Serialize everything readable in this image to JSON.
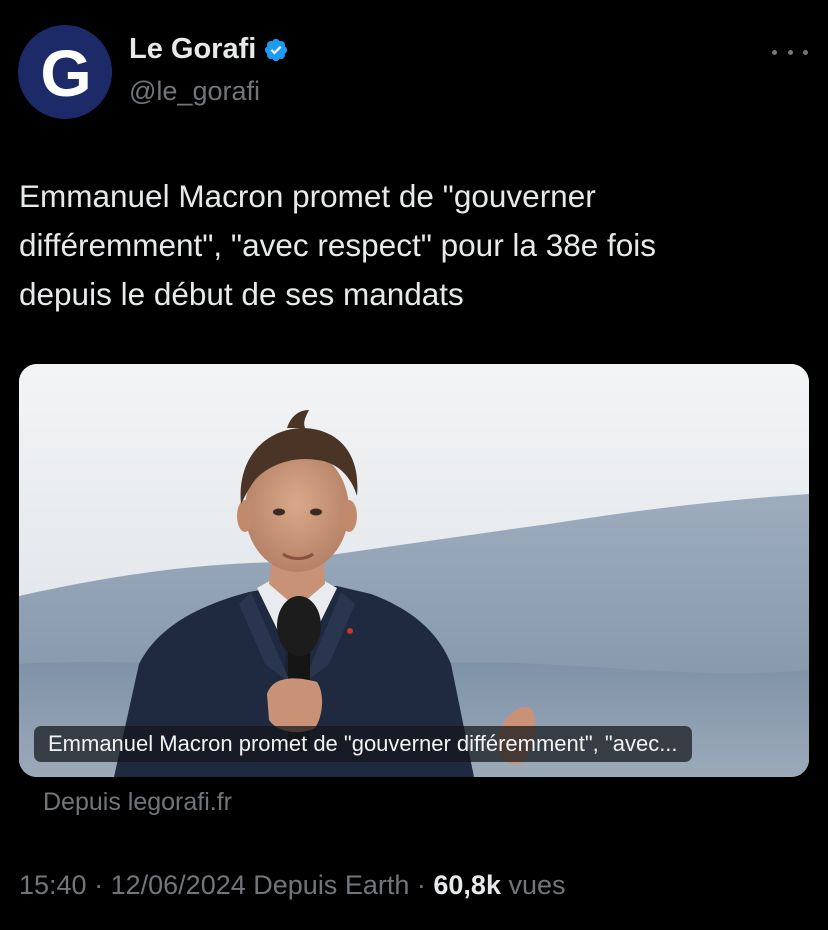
{
  "account": {
    "avatar_letter": "G",
    "display_name": "Le Gorafi",
    "handle": "@le_gorafi",
    "verified_icon": "verified-badge-icon",
    "avatar_color": "#1d2a68",
    "verified_color": "#1d9bf0"
  },
  "tweet": {
    "text": "Emmanuel Macron promet de \"gouverner\ndifféremment\", \"avec respect\" pour la 38e fois\ndepuis le début de ses mandats"
  },
  "card": {
    "caption": "Emmanuel Macron promet de \"gouverner différemment\", \"avec...",
    "source": "Depuis legorafi.fr"
  },
  "meta": {
    "time": "15:40",
    "date": "12/06/2024",
    "client": "Depuis Earth",
    "separator": "·",
    "views_count": "60,8k",
    "views_label": "vues"
  },
  "colors": {
    "background": "#000000",
    "primary_text": "#e7e9ea",
    "secondary_text": "#71767b"
  }
}
